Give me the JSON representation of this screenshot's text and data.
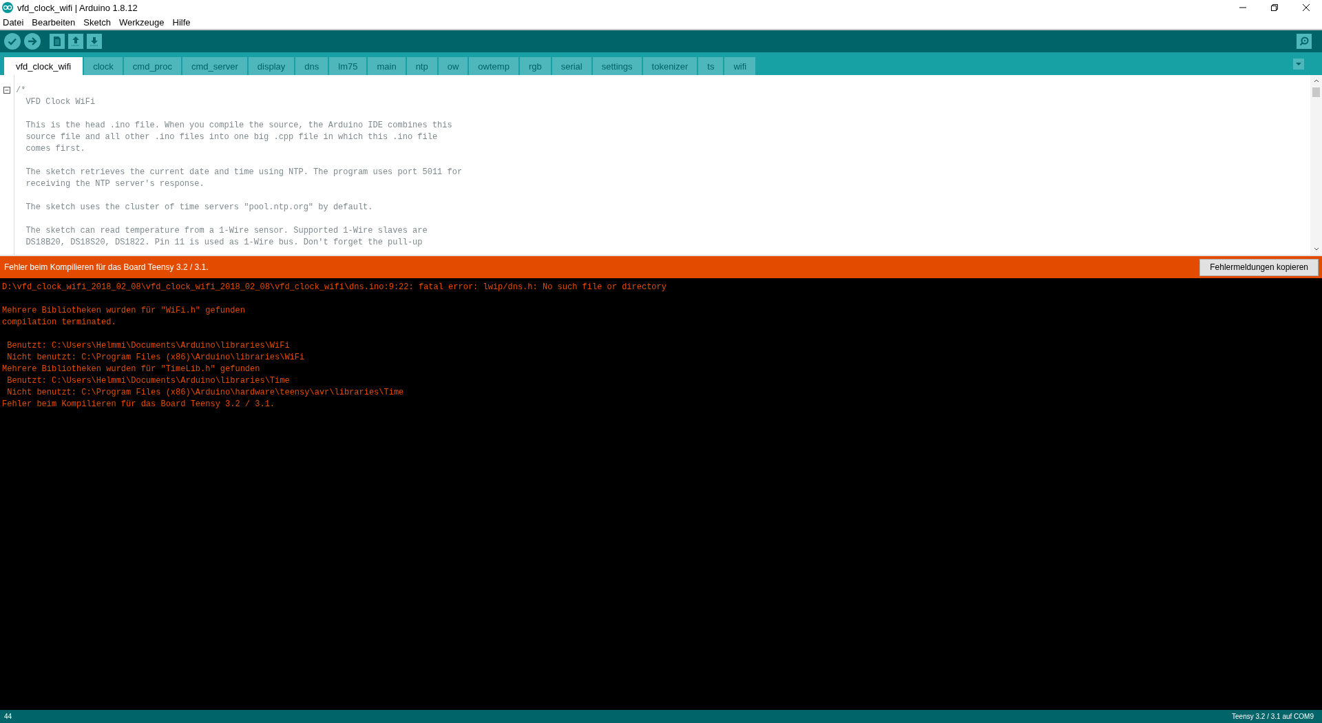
{
  "window": {
    "title": "vfd_clock_wifi | Arduino 1.8.12"
  },
  "menu": [
    "Datei",
    "Bearbeiten",
    "Sketch",
    "Werkzeuge",
    "Hilfe"
  ],
  "tabs": [
    {
      "label": "vfd_clock_wifi",
      "selected": true
    },
    {
      "label": "clock",
      "selected": false
    },
    {
      "label": "cmd_proc",
      "selected": false
    },
    {
      "label": "cmd_server",
      "selected": false
    },
    {
      "label": "display",
      "selected": false
    },
    {
      "label": "dns",
      "selected": false
    },
    {
      "label": "lm75",
      "selected": false
    },
    {
      "label": "main",
      "selected": false
    },
    {
      "label": "ntp",
      "selected": false
    },
    {
      "label": "ow",
      "selected": false
    },
    {
      "label": "owtemp",
      "selected": false
    },
    {
      "label": "rgb",
      "selected": false
    },
    {
      "label": "serial",
      "selected": false
    },
    {
      "label": "settings",
      "selected": false
    },
    {
      "label": "tokenizer",
      "selected": false
    },
    {
      "label": "ts",
      "selected": false
    },
    {
      "label": "wifi",
      "selected": false
    }
  ],
  "editor": {
    "paragraphs": [
      [
        "/*",
        "  VFD Clock WiFi"
      ],
      [
        "  This is the head .ino file. When you compile the source, the Arduino IDE combines this",
        "  source file and all other .ino files into one big .cpp file in which this .ino file",
        "  comes first."
      ],
      [
        "  The sketch retrieves the current date and time using NTP. The program uses port 5011 for",
        "  receiving the NTP server's response."
      ],
      [
        "  The sketch uses the cluster of time servers \"pool.ntp.org\" by default."
      ],
      [
        "  The sketch can read temperature from a 1-Wire sensor. Supported 1-Wire slaves are",
        "  DS18B20, DS18S20, DS1822. Pin 11 is used as 1-Wire bus. Don't forget the pull-up"
      ]
    ]
  },
  "message_bar": {
    "text": "Fehler beim Kompilieren für das Board Teensy 3.2 / 3.1.",
    "button": "Fehlermeldungen kopieren"
  },
  "console": {
    "paragraphs": [
      [
        "D:\\vfd_clock_wifi_2018_02_08\\vfd_clock_wifi_2018_02_08\\vfd_clock_wifi\\dns.ino:9:22: fatal error: lwip/dns.h: No such file or directory"
      ],
      [
        "Mehrere Bibliotheken wurden für \"WiFi.h\" gefunden",
        "compilation terminated."
      ],
      [
        " Benutzt: C:\\Users\\Helmmi\\Documents\\Arduino\\libraries\\WiFi",
        " Nicht benutzt: C:\\Program Files (x86)\\Arduino\\libraries\\WiFi",
        "Mehrere Bibliotheken wurden für \"TimeLib.h\" gefunden",
        " Benutzt: C:\\Users\\Helmmi\\Documents\\Arduino\\libraries\\Time",
        " Nicht benutzt: C:\\Program Files (x86)\\Arduino\\hardware\\teensy\\avr\\libraries\\Time",
        "Fehler beim Kompilieren für das Board Teensy 3.2 / 3.1."
      ]
    ]
  },
  "status_bar": {
    "line": "44",
    "board": "Teensy 3.2 / 3.1 auf COM9"
  }
}
